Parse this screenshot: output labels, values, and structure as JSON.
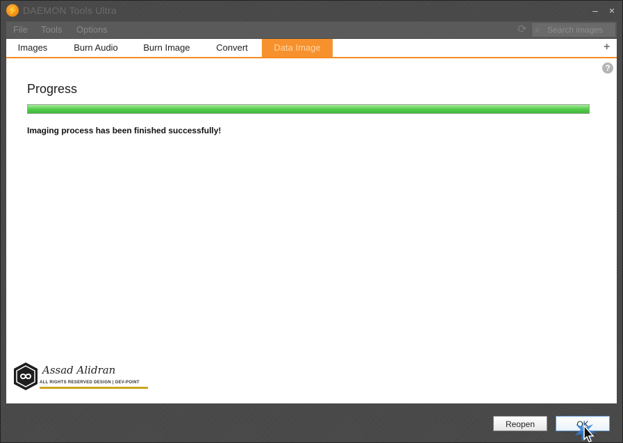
{
  "window": {
    "title": "DAEMON Tools Ultra",
    "minimize_glyph": "–",
    "close_glyph": "×"
  },
  "menu": {
    "items": [
      "File",
      "Tools",
      "Options"
    ]
  },
  "search": {
    "placeholder": "Search images"
  },
  "tabs": [
    {
      "label": "Images",
      "active": false
    },
    {
      "label": "Burn Audio",
      "active": false
    },
    {
      "label": "Burn Image",
      "active": false
    },
    {
      "label": "Convert",
      "active": false
    },
    {
      "label": "Data Image",
      "active": true
    }
  ],
  "tab_add_glyph": "+",
  "main": {
    "section_title": "Progress",
    "progress_fraction": 1.0,
    "status_message": "Imaging process has been finished successfully!",
    "help_glyph": "?"
  },
  "watermark": {
    "name": "Assad Alidran",
    "subtitle": "ALL RIGHTS RESERVED DESIGN | DEV-POINT"
  },
  "footer": {
    "reopen_label": "Reopen",
    "ok_label": "OK"
  },
  "colors": {
    "accent": "#f68b1f",
    "progress": "#4fc447"
  }
}
